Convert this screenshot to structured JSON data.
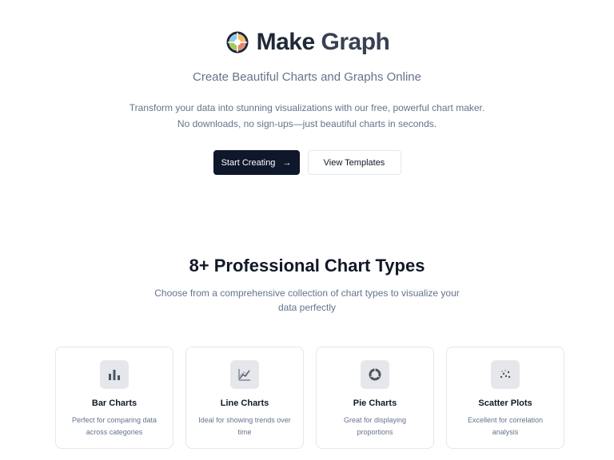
{
  "brand": {
    "name_part1": "Make ",
    "name_part2": "Graph",
    "logo_icon": "multicolor-ring-logo",
    "colors": [
      "#f4a261",
      "#e76f51",
      "#8ecae6",
      "#a7c957",
      "#f6bd60"
    ]
  },
  "hero": {
    "subtitle": "Create Beautiful Charts and Graphs Online",
    "desc_line1": "Transform your data into stunning visualizations with our free, powerful chart maker.",
    "desc_line2": "No downloads, no sign-ups—just beautiful charts in seconds.",
    "primary_button": "Start Creating",
    "primary_button_icon": "arrow-right-icon",
    "secondary_button": "View Templates"
  },
  "features": {
    "title": "8+ Professional Chart Types",
    "desc": "Choose from a comprehensive collection of chart types to visualize your data perfectly",
    "cards": [
      {
        "title": "Bar Charts",
        "text": "Perfect for comparing data across categories",
        "icon": "bar-chart-icon"
      },
      {
        "title": "Line Charts",
        "text": "Ideal for showing trends over time",
        "icon": "line-chart-icon"
      },
      {
        "title": "Pie Charts",
        "text": "Great for displaying proportions",
        "icon": "pie-chart-icon"
      },
      {
        "title": "Scatter Plots",
        "text": "Excellent for correlation analysis",
        "icon": "scatter-plot-icon"
      }
    ]
  },
  "theme": {
    "primary": "#0f172a",
    "muted_text": "#64748b",
    "border": "#e5e7eb",
    "icon_bg": "#e5e7eb"
  }
}
